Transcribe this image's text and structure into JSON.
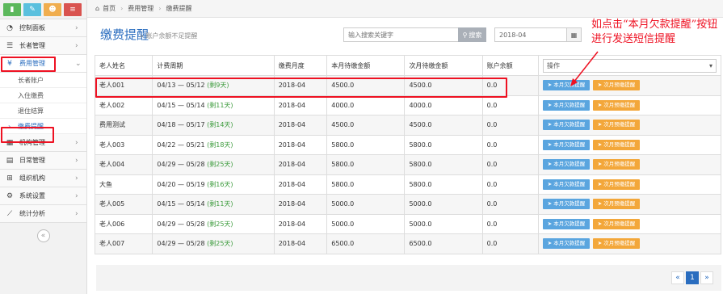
{
  "colors": {
    "primary": "#2a6dbf",
    "green_text": "#3c9b3c",
    "btn_blue": "#5aa5df",
    "btn_orange": "#f3a73a",
    "annotation_red": "#e12"
  },
  "sidebar": {
    "shortcuts": [
      {
        "icon": "chart-icon",
        "color": "#5cb85c"
      },
      {
        "icon": "pencil-icon",
        "color": "#5bc0de"
      },
      {
        "icon": "users-icon",
        "color": "#f0ad4e"
      },
      {
        "icon": "cogs-icon",
        "color": "#d9534f"
      }
    ],
    "items": [
      {
        "label": "控制面板",
        "icon": "dashboard-icon"
      },
      {
        "label": "长者管理",
        "icon": "list-icon"
      },
      {
        "label": "费用管理",
        "icon": "yen-icon"
      },
      {
        "label": "机构管理",
        "icon": "building-icon"
      },
      {
        "label": "日常管理",
        "icon": "calendar-icon"
      },
      {
        "label": "组织机构",
        "icon": "sitemap-icon"
      },
      {
        "label": "系统设置",
        "icon": "gears-icon"
      },
      {
        "label": "统计分析",
        "icon": "line-chart-icon"
      }
    ],
    "sub_items": [
      "长者账户",
      "入住缴费",
      "退住结算",
      "缴费提醒"
    ]
  },
  "breadcrumb": {
    "home": "首页",
    "level1": "费用管理",
    "level2": "缴费提醒"
  },
  "header": {
    "title": "缴费提醒",
    "subtitle": "» 账户余额不足提醒"
  },
  "search": {
    "placeholder": "输入搜索关键字",
    "button": "搜索"
  },
  "date_filter": {
    "value": "2018-04"
  },
  "table": {
    "columns": [
      "老人姓名",
      "计费周期",
      "缴费月度",
      "本月待缴金额",
      "次月待缴金额",
      "账户余额",
      "操作"
    ],
    "op_placeholder": "操作",
    "btn_owe": "本月欠款提醒",
    "btn_next": "次月预缴提醒",
    "rows": [
      {
        "name": "老人001",
        "period": "04/13 — 05/12",
        "remain": "(剩9天)",
        "month": "2018-04",
        "cur": "4500.0",
        "next": "4500.0",
        "balance": "0.0"
      },
      {
        "name": "老人002",
        "period": "04/15 — 05/14",
        "remain": "(剩11天)",
        "month": "2018-04",
        "cur": "4000.0",
        "next": "4000.0",
        "balance": "0.0"
      },
      {
        "name": "费用测试",
        "period": "04/18 — 05/17",
        "remain": "(剩14天)",
        "month": "2018-04",
        "cur": "4500.0",
        "next": "4500.0",
        "balance": "0.0"
      },
      {
        "name": "老人003",
        "period": "04/22 — 05/21",
        "remain": "(剩18天)",
        "month": "2018-04",
        "cur": "5800.0",
        "next": "5800.0",
        "balance": "0.0"
      },
      {
        "name": "老人004",
        "period": "04/29 — 05/28",
        "remain": "(剩25天)",
        "month": "2018-04",
        "cur": "5800.0",
        "next": "5800.0",
        "balance": "0.0"
      },
      {
        "name": "大鱼",
        "period": "04/20 — 05/19",
        "remain": "(剩16天)",
        "month": "2018-04",
        "cur": "5800.0",
        "next": "5800.0",
        "balance": "0.0"
      },
      {
        "name": "老人005",
        "period": "04/15 — 05/14",
        "remain": "(剩11天)",
        "month": "2018-04",
        "cur": "5000.0",
        "next": "5000.0",
        "balance": "0.0"
      },
      {
        "name": "老人006",
        "period": "04/29 — 05/28",
        "remain": "(剩25天)",
        "month": "2018-04",
        "cur": "5000.0",
        "next": "5000.0",
        "balance": "0.0"
      },
      {
        "name": "老人007",
        "period": "04/29 — 05/28",
        "remain": "(剩25天)",
        "month": "2018-04",
        "cur": "6500.0",
        "next": "6500.0",
        "balance": "0.0"
      }
    ]
  },
  "annotation": "如点击“本月欠款提醒”按钮进行发送短信提醒",
  "pagination": {
    "prev": "«",
    "current": "1",
    "next": "»"
  }
}
